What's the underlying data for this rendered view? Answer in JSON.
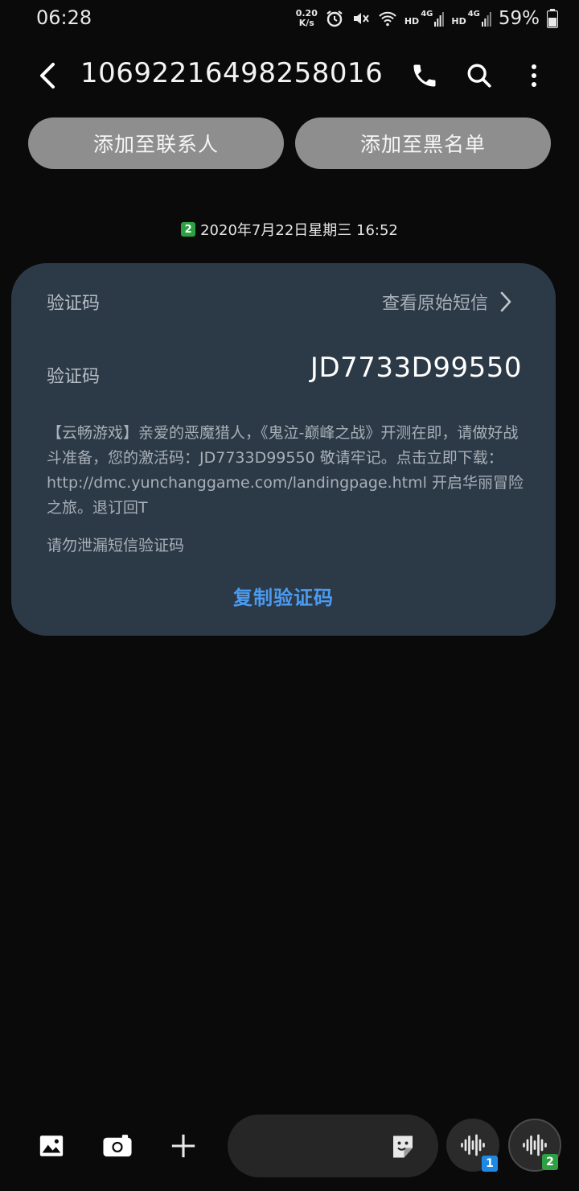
{
  "status_bar": {
    "time": "06:28",
    "net_speed_value": "0.20",
    "net_speed_unit": "K/s",
    "sim1_hd": "HD",
    "sim1_network": "4G",
    "sim2_hd": "HD",
    "sim2_network": "4G",
    "battery_percent": "59%"
  },
  "header": {
    "title": "10692216498258016"
  },
  "actions": {
    "add_contact": "添加至联系人",
    "add_blacklist": "添加至黑名单"
  },
  "message_date": {
    "sim_number": "2",
    "text": "2020年7月22日星期三 16:52"
  },
  "card": {
    "header_label": "验证码",
    "view_original": "查看原始短信",
    "code_label": "验证码",
    "code_value": "JD7733D99550",
    "body": "【云畅游戏】亲爱的恶魔猎人，《鬼泣-巅峰之战》开测在即，请做好战斗准备，您的激活码：JD7733D99550 敬请牢记。点击立即下载： http://dmc.yunchanggame.com/landingpage.html 开启华丽冒险之旅。退订回T",
    "warning": "请勿泄漏短信验证码",
    "copy_button": "复制验证码"
  },
  "bottom_bar": {
    "voice_sim1": "1",
    "voice_sim2": "2",
    "sim1_color": "#1e88e5",
    "sim2_color": "#2ea043"
  }
}
